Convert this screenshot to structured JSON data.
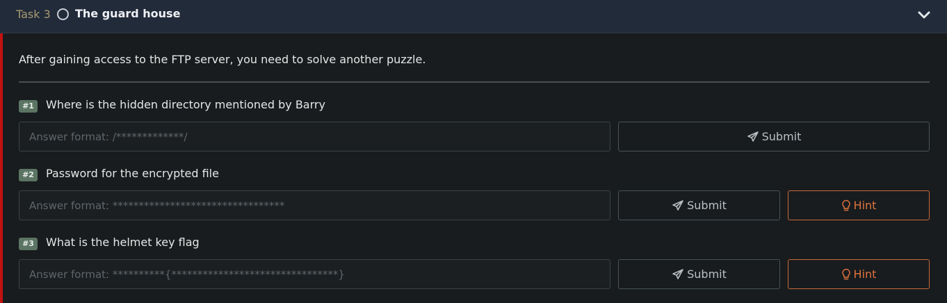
{
  "header": {
    "task_label": "Task 3",
    "title": "The guard house",
    "status_icon": "circle-icon",
    "collapse_icon": "chevron-down-icon"
  },
  "intro": "After gaining access to the FTP server, you need to solve another puzzle.",
  "questions": [
    {
      "number": "#1",
      "text": "Where is the hidden directory mentioned by Barry",
      "placeholder": "Answer format: /*************/",
      "value": "",
      "submit_label": "Submit"
    },
    {
      "number": "#2",
      "text": "Password for the encrypted file",
      "placeholder": "Answer format: *********************************",
      "value": "",
      "submit_label": "Submit",
      "hint_label": "Hint"
    },
    {
      "number": "#3",
      "text": "What is the helmet key flag",
      "placeholder": "Answer format: **********{********************************}",
      "value": "",
      "submit_label": "Submit",
      "hint_label": "Hint"
    }
  ],
  "colors": {
    "accent_bar": "#c11111",
    "hint": "#e0733f",
    "badge": "#5c7463"
  }
}
